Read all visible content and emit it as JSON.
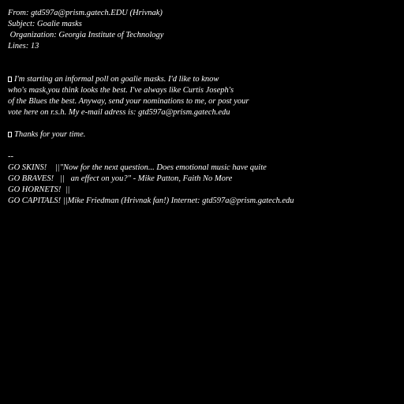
{
  "header": {
    "from": "From: gtd597a@prism.gatech.EDU (Hrivnak)",
    "subject": "Subject: Goalie masks",
    "organization": " Organization: Georgia Institute of Technology",
    "lines": "Lines: 13"
  },
  "body": {
    "lines": [
      "I'm starting an informal poll on goalie masks. I'd like to know",
      "who's mask,you think looks the best. I've always like Curtis Joseph's",
      "of the Blues the best. Anyway, send your nominations to me, or post your",
      "vote here on r.s.h. My e-mail adress is: gtd597a@prism.gatech.edu"
    ]
  },
  "thanks": "Thanks for your time.",
  "signature": {
    "separator": "--",
    "lines": [
      "GO SKINS!    ||\"Now for the next question... Does emotional music have quite",
      "GO BRAVES!   ||   an effect on you?\" - Mike Patton, Faith No More",
      "GO HORNETS!  ||",
      "GO CAPITALS! ||Mike Friedman (Hrivnak fan!) Internet: gtd597a@prism.gatech.edu"
    ]
  }
}
